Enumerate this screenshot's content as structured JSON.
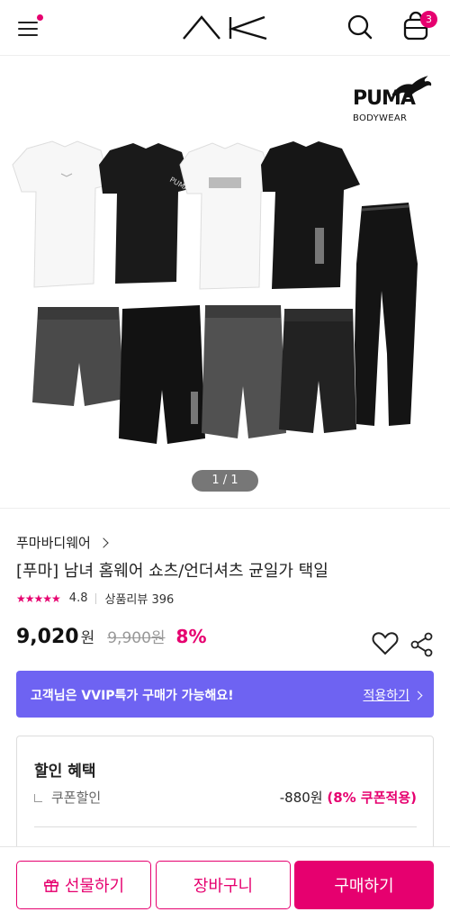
{
  "colors": {
    "accent": "#e6006f",
    "vvip": "#6e63f2"
  },
  "header": {
    "logo_text": "AK",
    "cart_count": "3",
    "icons": [
      "menu-icon",
      "search-icon",
      "cart-icon"
    ]
  },
  "product_image": {
    "brand_name": "PUMA",
    "brand_sub": "BODYWEAR",
    "pager": "1 / 1"
  },
  "info": {
    "brand_link": "푸마바디웨어",
    "title": "[푸마] 남녀 홈웨어 쇼츠/언더셔츠 균일가 택일",
    "stars": "★★★★★",
    "rating": "4.8",
    "review_label": "상품리뷰 396"
  },
  "price": {
    "current": "9,020",
    "unit": "원",
    "original": "9,900원",
    "discount_rate": "8%"
  },
  "vvip": {
    "text": "고객님은 VVIP특가 구매가 가능해요!",
    "link": "적용하기"
  },
  "discount": {
    "title": "할인 혜택",
    "coupon_label": "쿠폰할인",
    "coupon_amount": "-880원",
    "coupon_note": "(8% 쿠폰적용)"
  },
  "bottom_bar": {
    "gift": "선물하기",
    "cart": "장바구니",
    "buy": "구매하기"
  }
}
